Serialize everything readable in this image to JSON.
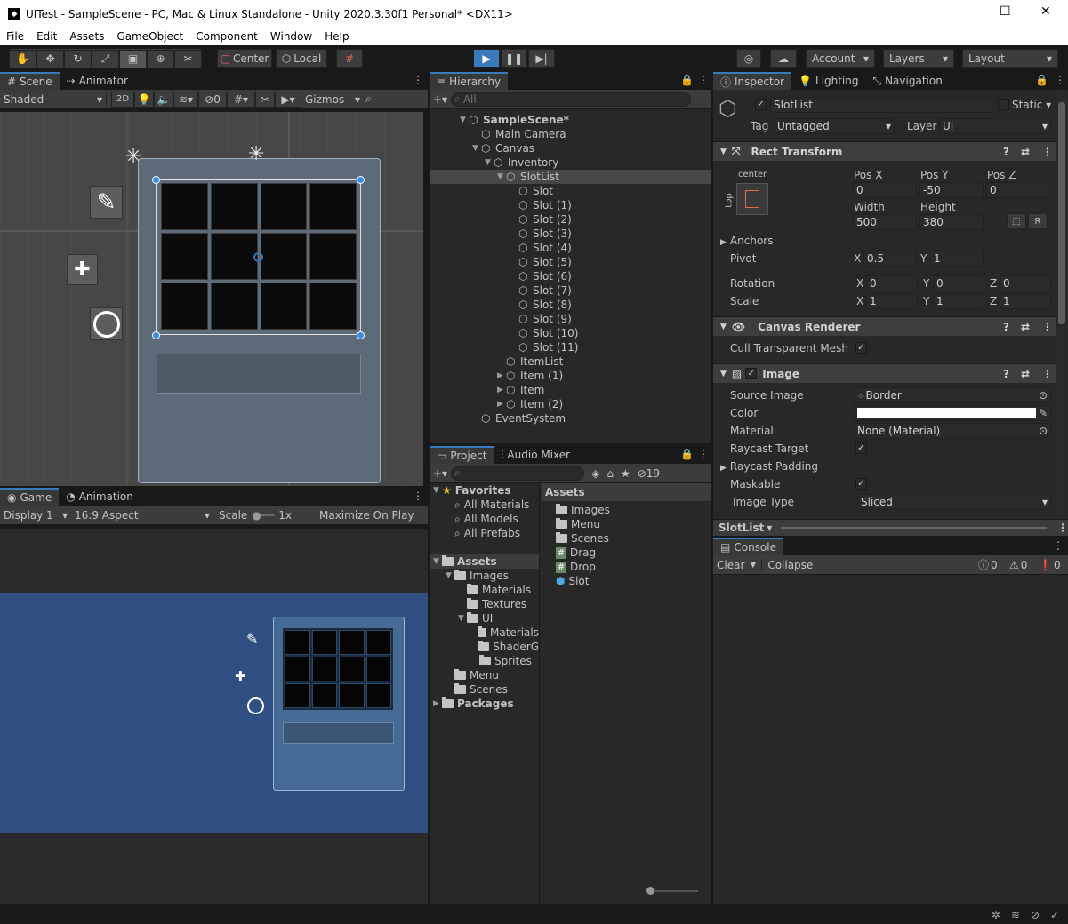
{
  "window": {
    "title": "UITest - SampleScene - PC, Mac & Linux Standalone - Unity 2020.3.30f1 Personal* <DX11>",
    "minimize": "—",
    "maximize": "☐",
    "close": "✕"
  },
  "menu": [
    "File",
    "Edit",
    "Assets",
    "GameObject",
    "Component",
    "Window",
    "Help"
  ],
  "toolbar": {
    "center": "Center",
    "local": "Local",
    "account": "Account",
    "layers": "Layers",
    "layout": "Layout"
  },
  "scene": {
    "tab_scene": "Scene",
    "tab_animator": "Animator",
    "shading": "Shaded",
    "mode2d": "2D",
    "hidden_count": "0",
    "gizmos": "Gizmos"
  },
  "game": {
    "tab_game": "Game",
    "tab_animation": "Animation",
    "display": "Display 1",
    "aspect": "16:9 Aspect",
    "scale_label": "Scale",
    "scale_value": "1x",
    "maximize": "Maximize On Play"
  },
  "hierarchy": {
    "tab": "Hierarchy",
    "search_placeholder": "All",
    "items": [
      {
        "label": "SampleScene*",
        "depth": 0,
        "arrow": "▼",
        "bold": true,
        "icon": "unity-scene-icon"
      },
      {
        "label": "Main Camera",
        "depth": 1,
        "arrow": "",
        "icon": "gameobject-icon"
      },
      {
        "label": "Canvas",
        "depth": 1,
        "arrow": "▼",
        "icon": "gameobject-icon"
      },
      {
        "label": "Inventory",
        "depth": 2,
        "arrow": "▼",
        "icon": "gameobject-icon"
      },
      {
        "label": "SlotList",
        "depth": 3,
        "arrow": "▼",
        "icon": "gameobject-icon",
        "selected": true
      },
      {
        "label": "Slot",
        "depth": 4,
        "arrow": "",
        "icon": "gameobject-icon"
      },
      {
        "label": "Slot (1)",
        "depth": 4,
        "arrow": "",
        "icon": "gameobject-icon"
      },
      {
        "label": "Slot (2)",
        "depth": 4,
        "arrow": "",
        "icon": "gameobject-icon"
      },
      {
        "label": "Slot (3)",
        "depth": 4,
        "arrow": "",
        "icon": "gameobject-icon"
      },
      {
        "label": "Slot (4)",
        "depth": 4,
        "arrow": "",
        "icon": "gameobject-icon"
      },
      {
        "label": "Slot (5)",
        "depth": 4,
        "arrow": "",
        "icon": "gameobject-icon"
      },
      {
        "label": "Slot (6)",
        "depth": 4,
        "arrow": "",
        "icon": "gameobject-icon"
      },
      {
        "label": "Slot (7)",
        "depth": 4,
        "arrow": "",
        "icon": "gameobject-icon"
      },
      {
        "label": "Slot (8)",
        "depth": 4,
        "arrow": "",
        "icon": "gameobject-icon"
      },
      {
        "label": "Slot (9)",
        "depth": 4,
        "arrow": "",
        "icon": "gameobject-icon"
      },
      {
        "label": "Slot (10)",
        "depth": 4,
        "arrow": "",
        "icon": "gameobject-icon"
      },
      {
        "label": "Slot (11)",
        "depth": 4,
        "arrow": "",
        "icon": "gameobject-icon"
      },
      {
        "label": "ItemList",
        "depth": 3,
        "arrow": "",
        "icon": "gameobject-icon"
      },
      {
        "label": "Item (1)",
        "depth": 3,
        "arrow": "▶",
        "icon": "gameobject-icon"
      },
      {
        "label": "Item",
        "depth": 3,
        "arrow": "▶",
        "icon": "gameobject-icon"
      },
      {
        "label": "Item (2)",
        "depth": 3,
        "arrow": "▶",
        "icon": "gameobject-icon"
      },
      {
        "label": "EventSystem",
        "depth": 1,
        "arrow": "",
        "icon": "gameobject-icon"
      }
    ]
  },
  "project": {
    "tab_project": "Project",
    "tab_audio": "Audio Mixer",
    "hidden_count": "19",
    "tree": [
      {
        "label": "Favorites",
        "depth": 0,
        "arrow": "▼",
        "bold": true,
        "icon": "star-icon"
      },
      {
        "label": "All Materials",
        "depth": 1,
        "arrow": "",
        "icon": "search-icon"
      },
      {
        "label": "All Models",
        "depth": 1,
        "arrow": "",
        "icon": "search-icon"
      },
      {
        "label": "All Prefabs",
        "depth": 1,
        "arrow": "",
        "icon": "search-icon"
      },
      {
        "label": "",
        "depth": 0,
        "arrow": "",
        "icon": "spacer"
      },
      {
        "label": "Assets",
        "depth": 0,
        "arrow": "▼",
        "bold": true,
        "icon": "folder-icon"
      },
      {
        "label": "Images",
        "depth": 1,
        "arrow": "▼",
        "icon": "folder-icon"
      },
      {
        "label": "Materials",
        "depth": 2,
        "arrow": "",
        "icon": "folder-icon"
      },
      {
        "label": "Textures",
        "depth": 2,
        "arrow": "",
        "icon": "folder-icon"
      },
      {
        "label": "UI",
        "depth": 2,
        "arrow": "▼",
        "icon": "folder-icon"
      },
      {
        "label": "Materials",
        "depth": 3,
        "arrow": "",
        "icon": "folder-icon"
      },
      {
        "label": "ShaderG",
        "depth": 3,
        "arrow": "",
        "icon": "folder-icon"
      },
      {
        "label": "Sprites",
        "depth": 3,
        "arrow": "",
        "icon": "folder-icon"
      },
      {
        "label": "Menu",
        "depth": 1,
        "arrow": "",
        "icon": "folder-icon"
      },
      {
        "label": "Scenes",
        "depth": 1,
        "arrow": "",
        "icon": "folder-icon"
      },
      {
        "label": "Packages",
        "depth": 0,
        "arrow": "▶",
        "bold": true,
        "icon": "folder-icon"
      }
    ],
    "assets_header": "Assets",
    "assets": [
      {
        "label": "Images",
        "icon": "folder-icon"
      },
      {
        "label": "Menu",
        "icon": "folder-icon"
      },
      {
        "label": "Scenes",
        "icon": "folder-icon"
      },
      {
        "label": "Drag",
        "icon": "script-icon"
      },
      {
        "label": "Drop",
        "icon": "script-icon"
      },
      {
        "label": "Slot",
        "icon": "prefab-icon"
      }
    ]
  },
  "inspector": {
    "tab_inspector": "Inspector",
    "tab_lighting": "Lighting",
    "tab_navigation": "Navigation",
    "object_name": "SlotList",
    "static_label": "Static",
    "tag_label": "Tag",
    "tag_value": "Untagged",
    "layer_label": "Layer",
    "layer_value": "UI",
    "rect": {
      "title": "Rect Transform",
      "anchor_h": "center",
      "anchor_v": "top",
      "posx_label": "Pos X",
      "posy_label": "Pos Y",
      "posz_label": "Pos Z",
      "posx": "0",
      "posy": "-50",
      "posz": "0",
      "width_label": "Width",
      "height_label": "Height",
      "width": "500",
      "height": "380",
      "r_btn": "R",
      "anchors": "Anchors",
      "pivot": "Pivot",
      "pivot_x": "0.5",
      "pivot_y": "1",
      "rotation": "Rotation",
      "rot_x": "0",
      "rot_y": "0",
      "rot_z": "0",
      "scale": "Scale",
      "scale_x": "1",
      "scale_y": "1",
      "scale_z": "1",
      "x": "X",
      "y": "Y",
      "z": "Z"
    },
    "canvas_renderer": {
      "title": "Canvas Renderer",
      "cull": "Cull Transparent Mesh"
    },
    "image": {
      "title": "Image",
      "source_label": "Source Image",
      "source_value": "Border",
      "color_label": "Color",
      "material_label": "Material",
      "material_value": "None (Material)",
      "raycast_target": "Raycast Target",
      "raycast_padding": "Raycast Padding",
      "maskable": "Maskable",
      "image_type": "Image Type",
      "image_type_value": "Sliced"
    },
    "footer": "SlotList"
  },
  "console": {
    "tab": "Console",
    "clear": "Clear",
    "collapse": "Collapse",
    "info_count": "0",
    "warn_count": "0",
    "error_count": "0"
  },
  "colors": {
    "accent": "#3a79bb",
    "game_bg": "#2f4f82",
    "panel": "#282828"
  }
}
